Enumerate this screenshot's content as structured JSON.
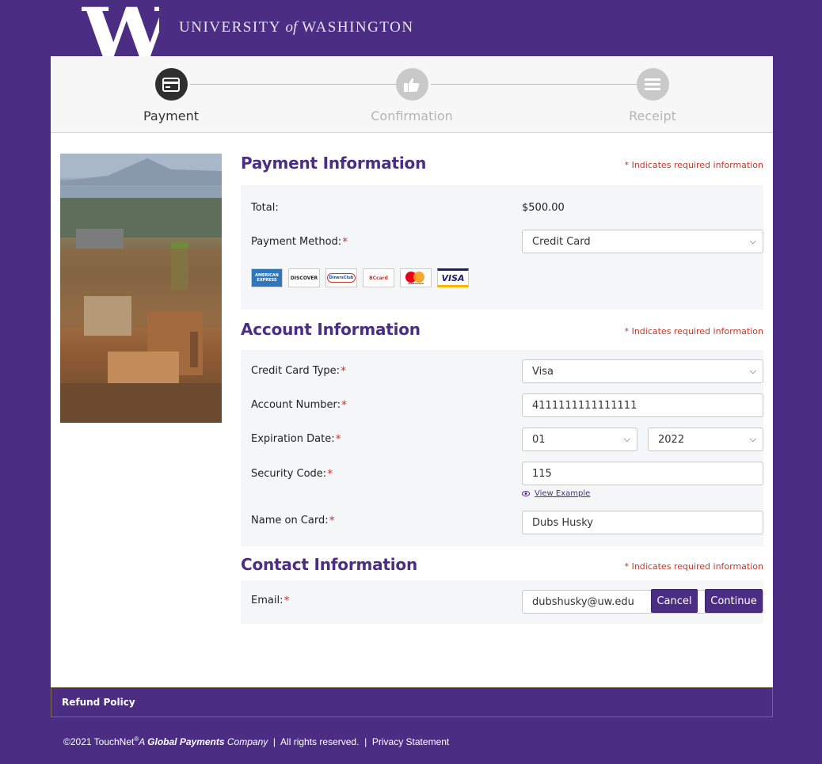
{
  "header": {
    "logo_letter": "W",
    "university_pre": "UNIVERSITY",
    "university_of": "of",
    "university_post": "WASHINGTON"
  },
  "steps": [
    {
      "label": "Payment",
      "icon": "credit-card-icon",
      "state": "active"
    },
    {
      "label": "Confirmation",
      "icon": "thumbs-up-icon",
      "state": "inactive"
    },
    {
      "label": "Receipt",
      "icon": "list-icon",
      "state": "inactive"
    }
  ],
  "payment_info": {
    "title": "Payment Information",
    "required_note": "* Indicates required information",
    "total_label": "Total:",
    "total_value": "$500.00",
    "method_label": "Payment Method:",
    "method_value": "Credit Card",
    "cards": [
      "AMERICAN EXPRESS",
      "DISCOVER",
      "DinersClub",
      "BCcard",
      "mastercard",
      "VISA"
    ]
  },
  "account_info": {
    "title": "Account Information",
    "required_note": "* Indicates required information",
    "card_type_label": "Credit Card Type:",
    "card_type_value": "Visa",
    "account_number_label": "Account Number:",
    "account_number_value": "4111111111111111",
    "expiration_label": "Expiration Date:",
    "exp_month": "01",
    "exp_year": "2022",
    "security_label": "Security Code:",
    "security_value": "115",
    "view_example": "View Example",
    "name_label": "Name on Card:",
    "name_value": "Dubs Husky"
  },
  "contact_info": {
    "title": "Contact Information",
    "required_note": "* Indicates required information",
    "email_label": "Email:",
    "email_value": "dubshusky@uw.edu"
  },
  "buttons": {
    "cancel": "Cancel",
    "continue": "Continue"
  },
  "footer": {
    "refund_policy": "Refund Policy",
    "copyright_pre": "©2021 TouchNet",
    "reg_mark": "®",
    "company_a": "A ",
    "company_bold": "Global Payments",
    "company_post": " Company",
    "sep1": "  |  ",
    "rights": "All rights reserved.",
    "sep2": "  |  ",
    "privacy": "Privacy Statement"
  },
  "colors": {
    "brand_purple": "#4b2e83",
    "required_red": "#c0392b"
  }
}
